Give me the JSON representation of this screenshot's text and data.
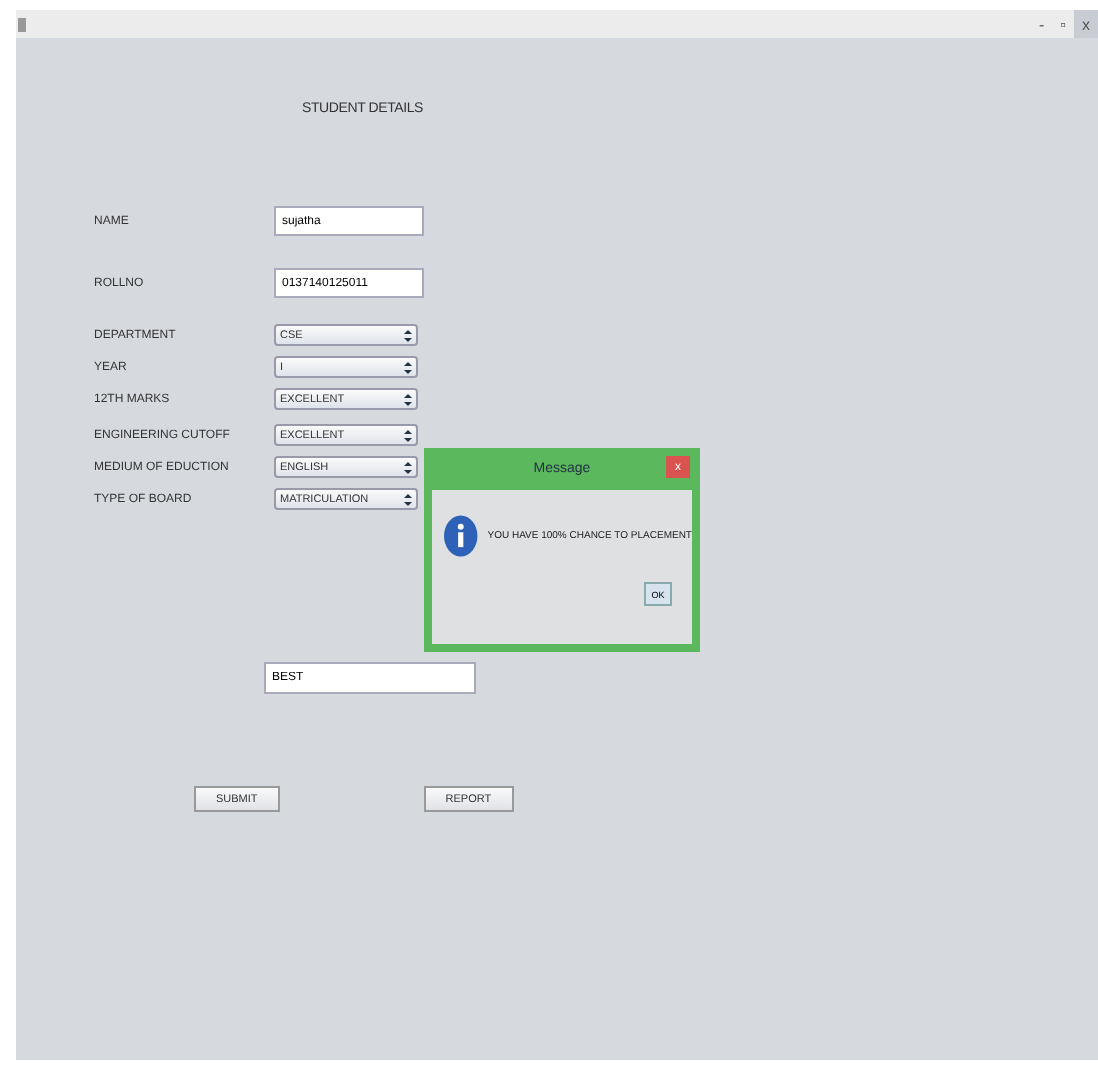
{
  "window": {
    "title_bar_controls": [
      "-",
      "▫",
      "x"
    ]
  },
  "heading": "STUDENT DETAILS",
  "fields": [
    {
      "kind": "text",
      "label": "NAME",
      "value": "sujatha"
    },
    {
      "kind": "text",
      "label": "ROLLNO",
      "value": "0137140125011"
    },
    {
      "kind": "select",
      "label": "DEPARTMENT",
      "value": "CSE"
    },
    {
      "kind": "select",
      "label": "YEAR",
      "value": "I"
    },
    {
      "kind": "select",
      "label": "12TH MARKS",
      "value": "EXCELLENT"
    },
    {
      "kind": "select",
      "label": "ENGINEERING CUTOFF",
      "value": "EXCELLENT"
    },
    {
      "kind": "select",
      "label": "MEDIUM OF EDUCTION",
      "value": "ENGLISH"
    },
    {
      "kind": "select",
      "label": "TYPE OF BOARD",
      "value": "MATRICULATION"
    }
  ],
  "result": {
    "value": "BEST"
  },
  "buttons": [
    "SUBMIT",
    "REPORT"
  ],
  "dialog": {
    "title": "Message",
    "close": "x",
    "message": "YOU HAVE 100% CHANCE TO PLACEMENT",
    "button": "OK"
  }
}
